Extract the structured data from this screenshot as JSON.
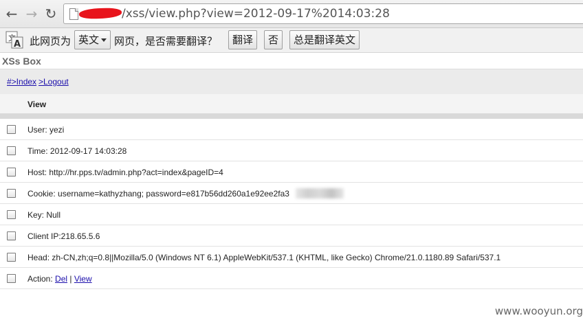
{
  "browser": {
    "back_icon": "←",
    "forward_icon": "→",
    "reload_icon": "↻",
    "url_visible": "/xss/view.php?view=2012-09-17%2014:03:28"
  },
  "translate": {
    "prompt_prefix": "此网页为",
    "language": "英文",
    "prompt_suffix": "网页，是否需要翻译？",
    "translate_button": "翻译",
    "no_button": "否",
    "always_button": "总是翻译英文"
  },
  "app": {
    "title": "XSs Box",
    "nav_index": "#>Index",
    "nav_logout": ">Logout",
    "view_header": "View"
  },
  "rows": [
    {
      "text": "User: yezi"
    },
    {
      "text": "Time: 2012-09-17 14:03:28"
    },
    {
      "text": "Host: http://hr.pps.tv/admin.php?act=index&pageID=4"
    },
    {
      "text": "Cookie: username=kathyzhang; password=e817b56dd260a1e92ee2fa3"
    },
    {
      "text": "Key: Null"
    },
    {
      "text": "Client IP:218.65.5.6"
    },
    {
      "text": "Head: zh-CN,zh;q=0.8||Mozilla/5.0 (Windows NT 6.1) AppleWebKit/537.1 (KHTML, like Gecko) Chrome/21.0.1180.89 Safari/537.1"
    }
  ],
  "action": {
    "label": "Action: ",
    "del": "Del",
    "separator": " | ",
    "view": "View"
  },
  "watermark": "www.wooyun.org"
}
